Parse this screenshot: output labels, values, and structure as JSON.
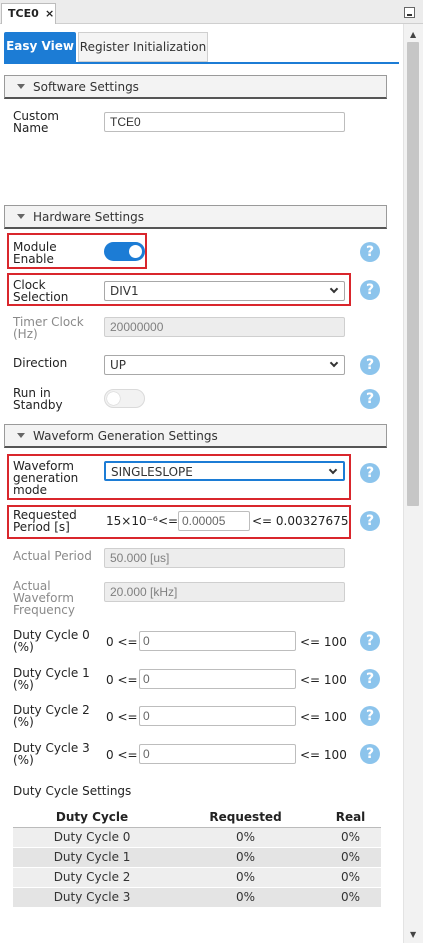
{
  "tab": {
    "title": "TCE0",
    "close": "×"
  },
  "view_tabs": {
    "easy": "Easy View",
    "register": "Register Initialization"
  },
  "help_symbol": "?",
  "software": {
    "header": "Software Settings",
    "custom_name_label": "Custom Name",
    "custom_name_value": "TCE0"
  },
  "hardware": {
    "header": "Hardware Settings",
    "module_enable_label": "Module Enable",
    "module_enable": true,
    "clock_selection_label": "Clock Selection",
    "clock_selection_value": "DIV1",
    "timer_clock_label": "Timer Clock (Hz)",
    "timer_clock_value": "20000000",
    "direction_label": "Direction",
    "direction_value": "UP",
    "run_standby_label": "Run in Standby",
    "run_standby": false
  },
  "waveform": {
    "header": "Waveform Generation Settings",
    "mode_label": "Waveform generation mode",
    "mode_value": "SINGLESLOPE",
    "period_label": "Requested Period [s]",
    "period_min": "15×10⁻⁶",
    "le": "<=",
    "period_value": "0.00005",
    "period_max": "<= 0.00327675",
    "actual_period_label": "Actual Period",
    "actual_period_value": "50.000 [us]",
    "actual_freq_label": "Actual Waveform Frequency",
    "actual_freq_value": "20.000 [kHz]",
    "duty_cycles": [
      {
        "label": "Duty Cycle 0 (%)",
        "min": "0 <=",
        "value": "0",
        "max": "<= 100"
      },
      {
        "label": "Duty Cycle 1 (%)",
        "min": "0 <=",
        "value": "0",
        "max": "<= 100"
      },
      {
        "label": "Duty Cycle 2 (%)",
        "min": "0 <=",
        "value": "0",
        "max": "<= 100"
      },
      {
        "label": "Duty Cycle 3 (%)",
        "min": "0 <=",
        "value": "0",
        "max": "<= 100"
      }
    ],
    "duty_settings_title": "Duty Cycle Settings",
    "table": {
      "headers": [
        "Duty Cycle",
        "Requested",
        "Real"
      ],
      "rows": [
        [
          "Duty Cycle 0",
          "0%",
          "0%"
        ],
        [
          "Duty Cycle 1",
          "0%",
          "0%"
        ],
        [
          "Duty Cycle 2",
          "0%",
          "0%"
        ],
        [
          "Duty Cycle 3",
          "0%",
          "0%"
        ]
      ]
    }
  },
  "colors": {
    "accent": "#1c7cd5",
    "highlight": "#d9262c",
    "help": "#8cc4ec"
  }
}
